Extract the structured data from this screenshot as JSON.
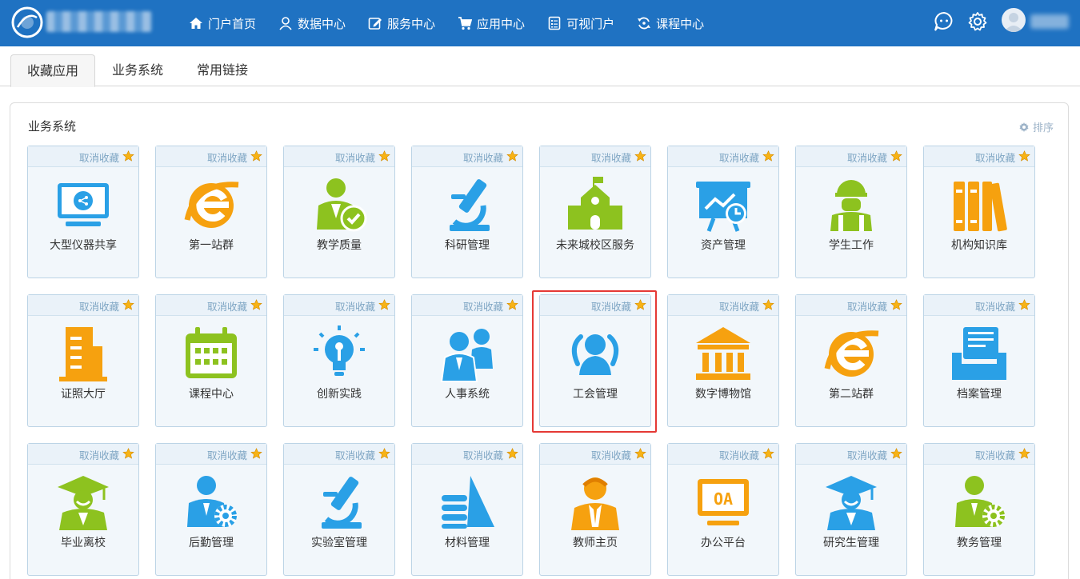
{
  "nav": {
    "items": [
      {
        "label": "门户首页",
        "icon": "home-icon"
      },
      {
        "label": "数据中心",
        "icon": "user-icon"
      },
      {
        "label": "服务中心",
        "icon": "edit-icon"
      },
      {
        "label": "应用中心",
        "icon": "cart-icon"
      },
      {
        "label": "可视门户",
        "icon": "list-icon"
      },
      {
        "label": "课程中心",
        "icon": "refresh-icon"
      }
    ]
  },
  "tabs": [
    {
      "label": "收藏应用",
      "active": true
    },
    {
      "label": "业务系统",
      "active": false
    },
    {
      "label": "常用链接",
      "active": false
    }
  ],
  "section": {
    "title": "业务系统",
    "sort_label": "排序"
  },
  "card_action_label": "取消收藏",
  "apps": [
    {
      "label": "大型仪器共享",
      "icon": "monitor-share-icon"
    },
    {
      "label": "第一站群",
      "icon": "ie-orange-icon"
    },
    {
      "label": "教学质量",
      "icon": "teacher-check-icon"
    },
    {
      "label": "科研管理",
      "icon": "microscope-icon"
    },
    {
      "label": "未来城校区服务",
      "icon": "school-building-icon"
    },
    {
      "label": "资产管理",
      "icon": "board-clock-icon"
    },
    {
      "label": "学生工作",
      "icon": "worker-icon"
    },
    {
      "label": "机构知识库",
      "icon": "books-icon"
    },
    {
      "label": "证照大厅",
      "icon": "office-building-icon"
    },
    {
      "label": "课程中心",
      "icon": "calendar-icon"
    },
    {
      "label": "创新实践",
      "icon": "lightbulb-icon"
    },
    {
      "label": "人事系统",
      "icon": "people-icon"
    },
    {
      "label": "工会管理",
      "icon": "union-people-icon"
    },
    {
      "label": "数字博物馆",
      "icon": "museum-icon"
    },
    {
      "label": "第二站群",
      "icon": "ie-orange-icon"
    },
    {
      "label": "档案管理",
      "icon": "archive-box-icon"
    },
    {
      "label": "毕业离校",
      "icon": "graduate-green-icon"
    },
    {
      "label": "后勤管理",
      "icon": "person-gear-blue-icon"
    },
    {
      "label": "实验室管理",
      "icon": "microscope-icon"
    },
    {
      "label": "材料管理",
      "icon": "pyramid-icon"
    },
    {
      "label": "教师主页",
      "icon": "teacher-orange-icon"
    },
    {
      "label": "办公平台",
      "icon": "oa-screen-icon"
    },
    {
      "label": "研究生管理",
      "icon": "graduate-blue-icon"
    },
    {
      "label": "教务管理",
      "icon": "person-gear-green-icon"
    }
  ],
  "colors": {
    "topbar": "#1f72c2",
    "orange": "#f6a10f",
    "blue": "#2aa0e6",
    "green": "#8dc21f",
    "selection": "#e53935"
  }
}
